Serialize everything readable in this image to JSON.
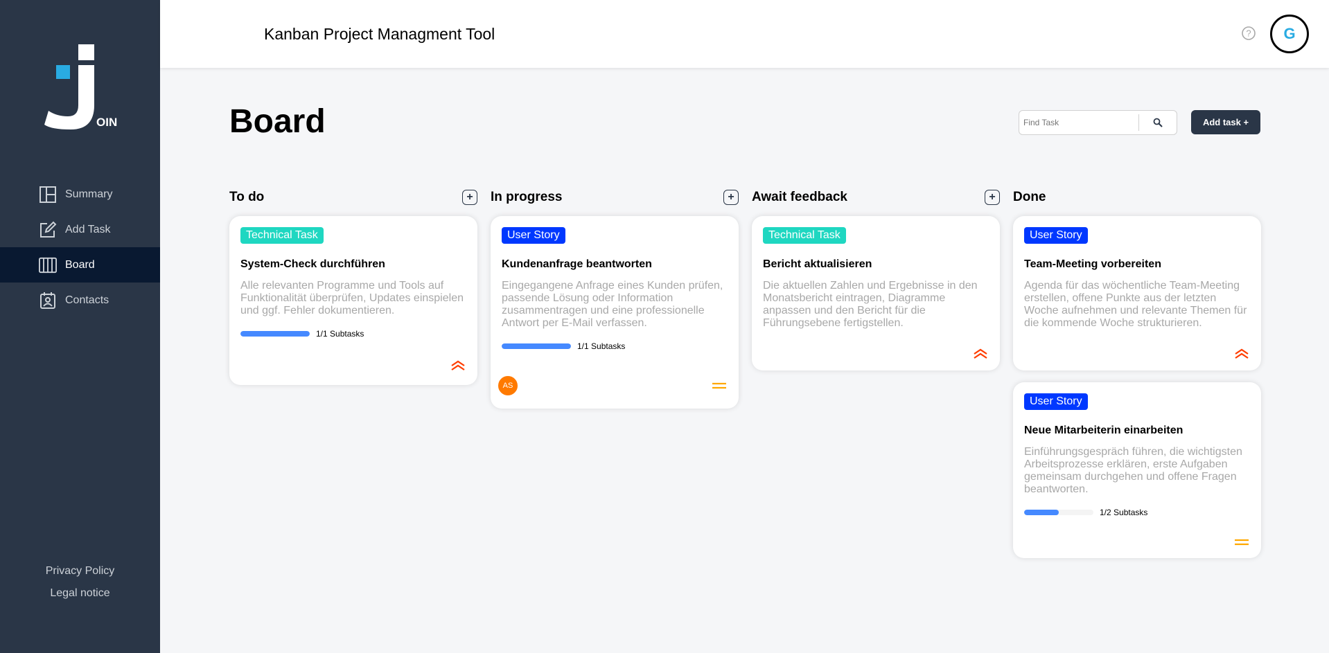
{
  "app": {
    "logo_text": "OIN",
    "header_title": "Kanban Project Managment Tool",
    "user_initial": "G",
    "help_symbol": "?"
  },
  "nav": [
    {
      "label": "Summary",
      "icon": "summary-icon"
    },
    {
      "label": "Add Task",
      "icon": "add-task-icon"
    },
    {
      "label": "Board",
      "icon": "board-icon",
      "active": true
    },
    {
      "label": "Contacts",
      "icon": "contacts-icon"
    }
  ],
  "footer": {
    "privacy": "Privacy Policy",
    "legal": "Legal notice"
  },
  "board": {
    "title": "Board",
    "search_placeholder": "Find Task",
    "add_task_label": "Add task +",
    "plus_symbol": "+"
  },
  "columns": [
    {
      "title": "To do",
      "has_plus": true
    },
    {
      "title": "In progress",
      "has_plus": true
    },
    {
      "title": "Await feedback",
      "has_plus": true
    },
    {
      "title": "Done",
      "has_plus": false
    }
  ],
  "cards": [
    {
      "category": "Technical Task",
      "title": "System-Check durchführen",
      "description": "Alle relevanten Programme und Tools auf Funktionalität überprüfen, Updates einspielen und ggf. Fehler dokumentieren.",
      "subtasks_text": "1/1 Subtasks",
      "progress": 1.0,
      "priority": "urgent"
    },
    {
      "category": "User Story",
      "title": "Kundenanfrage beantworten",
      "description": "Eingegangene Anfrage eines Kunden prüfen, passende Lösung oder Information zusammentragen und eine professionelle Antwort per E-Mail verfassen.",
      "subtasks_text": "1/1 Subtasks",
      "progress": 1.0,
      "assignee": "AS",
      "priority": "medium"
    },
    {
      "category": "Technical Task",
      "title": "Bericht aktualisieren",
      "description": "Die aktuellen Zahlen und Ergebnisse in den Monatsbericht eintragen, Diagramme anpassen und den Bericht für die Führungsebene fertigstellen.",
      "priority": "urgent"
    },
    {
      "category": "User Story",
      "title": "Team-Meeting vorbereiten",
      "description": "Agenda für das wöchentliche Team-Meeting erstellen, offene Punkte aus der letzten Woche aufnehmen und relevante Themen für die kommende Woche strukturieren.",
      "priority": "urgent"
    },
    {
      "category": "User Story",
      "title": "Neue Mitarbeiterin einarbeiten",
      "description": "Einführungsgespräch führen, die wichtigsten Arbeitsprozesse erklären, erste Aufgaben gemeinsam durchgehen und offene Fragen beantworten.",
      "subtasks_text": "1/2 Subtasks",
      "progress": 0.5,
      "priority": "medium"
    }
  ],
  "colors": {
    "sidebar": "#2a3647",
    "sidebar_active": "#091931",
    "tag_technical": "#1fd7c1",
    "tag_story": "#0038ff",
    "progress": "#4589ff",
    "urgent": "#ff3d00",
    "medium": "#ffa800",
    "accent": "#29abe2"
  }
}
